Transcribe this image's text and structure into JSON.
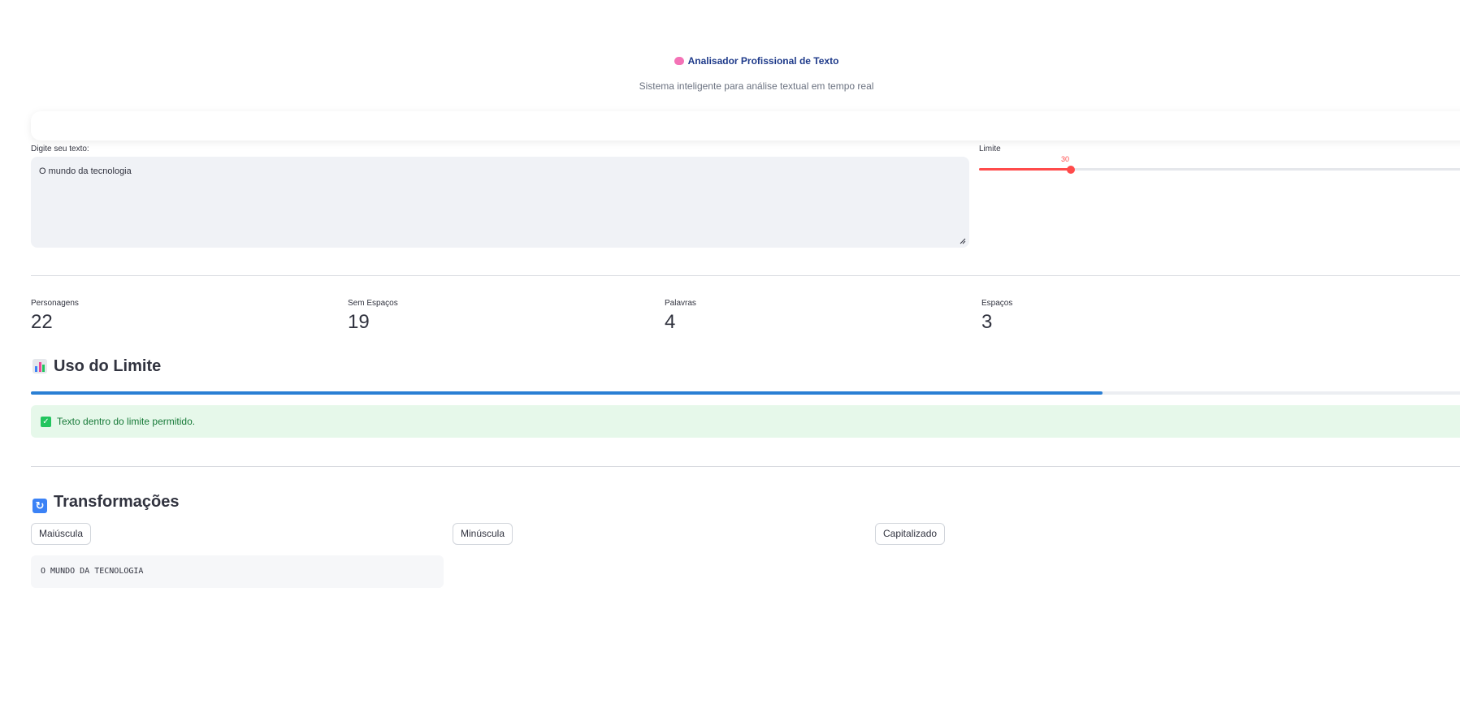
{
  "header": {
    "title": "Analisador Profissional de Texto",
    "subtitle": "Sistema inteligente para análise textual em tempo real"
  },
  "input": {
    "label": "Digite seu texto:",
    "value": "O mundo da tecnologia"
  },
  "limit": {
    "label": "Limite",
    "value": "30"
  },
  "metrics": [
    {
      "label": "Personagens",
      "value": "22"
    },
    {
      "label": "Sem Espaços",
      "value": "19"
    },
    {
      "label": "Palavras",
      "value": "4"
    },
    {
      "label": "Espaços",
      "value": "3"
    }
  ],
  "usage": {
    "heading": "Uso do Limite",
    "progress_fraction": 0.733,
    "alert_text": "Texto dentro do limite permitido."
  },
  "transforms": {
    "heading": "Transformações",
    "buttons": [
      "Maiúscula",
      "Minúscula",
      "Capitalizado"
    ],
    "output": "O MUNDO DA TECNOLOGIA"
  },
  "colors": {
    "accent_red": "#ff4b4b",
    "progress_blue": "#2a7fd4",
    "success_green": "#177a38",
    "title_blue": "#1e3a8a"
  },
  "icons": [
    "brain-icon",
    "bar-chart-icon",
    "check-icon",
    "refresh-icon"
  ]
}
